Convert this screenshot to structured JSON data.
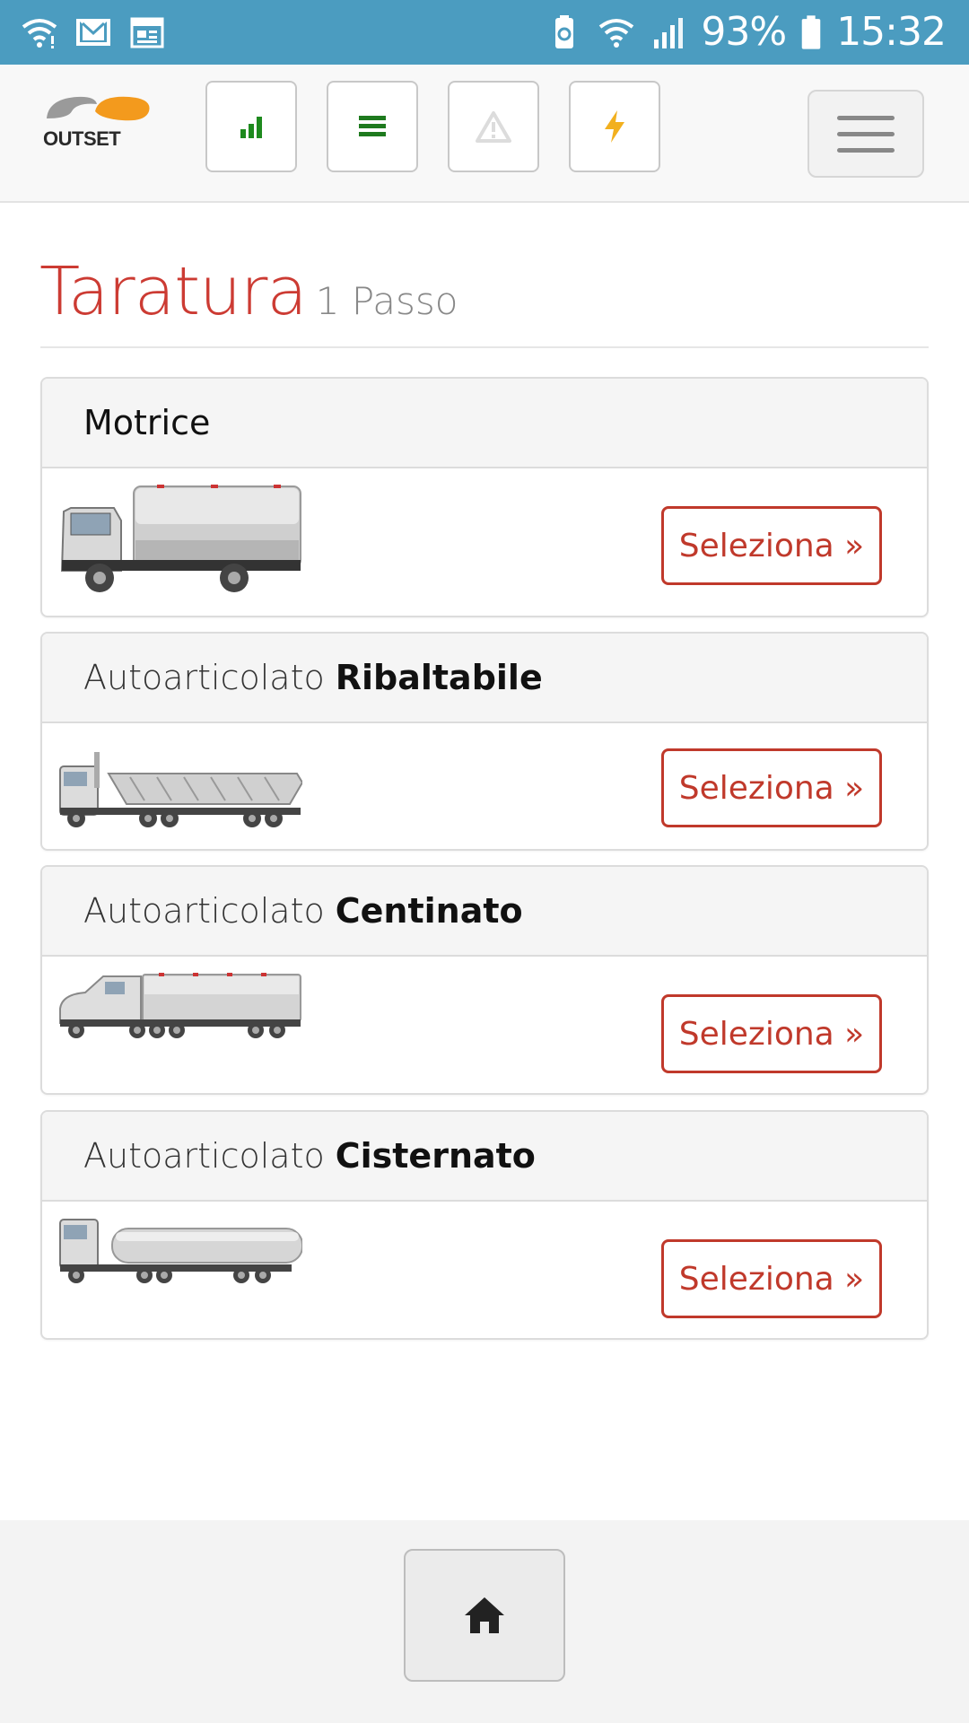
{
  "status_bar": {
    "battery": "93%",
    "time": "15:32",
    "icons_left": [
      "wifi-icon",
      "gmail-icon",
      "calendar-icon"
    ],
    "icons_right": [
      "battery-saver-icon",
      "wifi-icon",
      "signal-icon",
      "battery-icon"
    ]
  },
  "navbar": {
    "logo_text": "OUTSET",
    "buttons": [
      "signal-bars-icon",
      "list-icon",
      "warning-icon",
      "lightning-icon"
    ],
    "colors": {
      "signal": "#1e8a1e",
      "list": "#1e7a1e",
      "warning": "#dddddd",
      "lightning": "#f2b01e"
    }
  },
  "page": {
    "title": "Taratura",
    "subtitle": "1 Passo"
  },
  "vehicles": [
    {
      "prefix": "",
      "name": "Motrice",
      "button": "Seleziona »",
      "icon": "rigid-truck-icon"
    },
    {
      "prefix": "Autoarticolato",
      "name": "Ribaltabile",
      "button": "Seleziona »",
      "icon": "tipper-truck-icon"
    },
    {
      "prefix": "Autoarticolato",
      "name": "Centinato",
      "button": "Seleziona »",
      "icon": "curtain-truck-icon"
    },
    {
      "prefix": "Autoarticolato",
      "name": "Cisternato",
      "button": "Seleziona »",
      "icon": "tanker-truck-icon"
    }
  ],
  "footer": {
    "home_icon": "home-icon"
  },
  "theme": {
    "statusbar": "#4b9cc0",
    "accent": "#c0392b",
    "title": "#cc3b33"
  }
}
